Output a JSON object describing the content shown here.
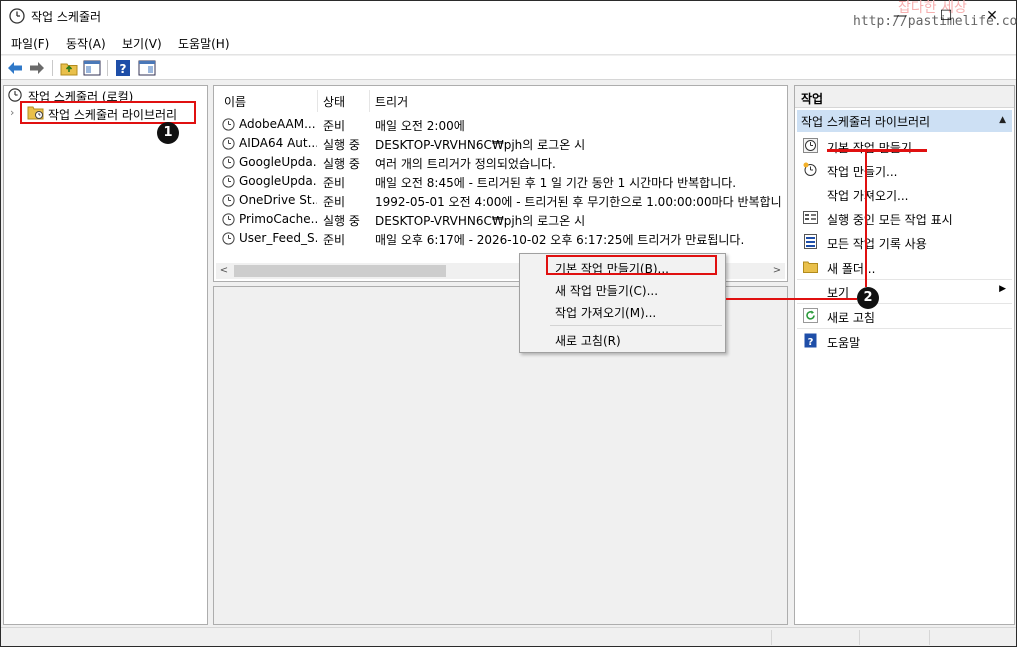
{
  "window": {
    "title": "작업 스케줄러",
    "watermark_title": "잡다한 세상",
    "watermark_url": "http://pastimelife.com",
    "min_glyph": "—",
    "max_glyph": "☐",
    "close_glyph": "✕"
  },
  "menu": [
    "파일(F)",
    "동작(A)",
    "보기(V)",
    "도움말(H)"
  ],
  "tree": {
    "root": "작업 스케줄러 (로컬)",
    "child": "작업 스케줄러 라이브러리"
  },
  "list": {
    "columns": [
      "이름",
      "상태",
      "트리거"
    ],
    "rows": [
      {
        "name": "AdobeAAM...",
        "status": "준비",
        "trigger": "매일 오전 2:00에"
      },
      {
        "name": "AIDA64 Aut...",
        "status": "실행 중",
        "trigger": "DESKTOP-VRVHN6C₩pjh의 로그온 시"
      },
      {
        "name": "GoogleUpda...",
        "status": "실행 중",
        "trigger": "여러 개의 트리거가 정의되었습니다."
      },
      {
        "name": "GoogleUpda...",
        "status": "준비",
        "trigger": "매일 오전 8:45에 - 트리거된 후 1 일 기간 동안 1 시간마다 반복합니다."
      },
      {
        "name": "OneDrive St...",
        "status": "준비",
        "trigger": "1992-05-01 오전 4:00에 - 트리거된 후 무기한으로 1.00:00:00마다 반복합니"
      },
      {
        "name": "PrimoCache...",
        "status": "실행 중",
        "trigger": "DESKTOP-VRVHN6C₩pjh의 로그온 시"
      },
      {
        "name": "User_Feed_S...",
        "status": "준비",
        "trigger": "매일 오후 6:17에 - 2026-10-02 오후 6:17:25에 트리거가 만료됩니다."
      }
    ]
  },
  "context_menu": [
    "기본 작업 만들기(B)...",
    "새 작업 만들기(C)...",
    "작업 가져오기(M)...",
    "새로 고침(R)"
  ],
  "actions": {
    "title": "작업",
    "section": "작업 스케줄러 라이브러리",
    "items": [
      {
        "label": "기본 작업 만들기...",
        "icon": "create-basic-task-icon"
      },
      {
        "label": "작업 만들기...",
        "icon": "create-task-icon"
      },
      {
        "label": "작업 가져오기...",
        "icon": ""
      },
      {
        "label": "실행 중인 모든 작업 표시",
        "icon": "running-tasks-icon"
      },
      {
        "label": "모든 작업 기록 사용",
        "icon": "history-icon"
      },
      {
        "label": "새 폴더...",
        "icon": "folder-icon"
      },
      {
        "label": "보기",
        "icon": ""
      },
      {
        "label": "새로 고침",
        "icon": "refresh-icon"
      },
      {
        "label": "도움말",
        "icon": "help-icon"
      }
    ]
  },
  "annotations": {
    "badge1": "1",
    "badge2": "2"
  },
  "colors": {
    "highlight_red": "#e01010",
    "section_blue": "#cde0f4"
  }
}
